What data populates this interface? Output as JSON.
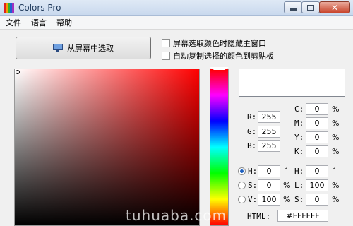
{
  "window": {
    "title": "Colors Pro",
    "app_icon_colors": [
      "#e02020",
      "#f0a000",
      "#30b030",
      "#2060d0",
      "#a030c0"
    ],
    "controls": {
      "minimize": "minimize",
      "maximize": "maximize",
      "close": "✕"
    }
  },
  "menu": [
    "文件",
    "语言",
    "帮助"
  ],
  "pick_button": {
    "label": "从屏幕中选取",
    "icon": "monitor-icon"
  },
  "options": [
    {
      "label": "屏幕选取颜色时隐藏主窗口",
      "checked": false
    },
    {
      "label": "自动复制选择的颜色到剪贴板",
      "checked": false
    }
  ],
  "picker": {
    "hue_color": "#ff0000",
    "preview_color": "#ffffff"
  },
  "rgb": {
    "r": {
      "label": "R:",
      "value": "255"
    },
    "g": {
      "label": "G:",
      "value": "255"
    },
    "b": {
      "label": "B:",
      "value": "255"
    }
  },
  "cmyk": {
    "c": {
      "label": "C:",
      "value": "0",
      "unit": "%"
    },
    "m": {
      "label": "M:",
      "value": "0",
      "unit": "%"
    },
    "y": {
      "label": "Y:",
      "value": "0",
      "unit": "%"
    },
    "k": {
      "label": "K:",
      "value": "0",
      "unit": "%"
    }
  },
  "hsv": {
    "h": {
      "label": "H:",
      "value": "0",
      "unit": "°",
      "selected": true
    },
    "s": {
      "label": "S:",
      "value": "0",
      "unit": "%",
      "selected": false
    },
    "v": {
      "label": "V:",
      "value": "100",
      "unit": "%",
      "selected": false
    }
  },
  "hsl": {
    "h": {
      "label": "H:",
      "value": "0",
      "unit": "°"
    },
    "l": {
      "label": "L:",
      "value": "100",
      "unit": "%"
    },
    "s": {
      "label": "S:",
      "value": "0",
      "unit": "%"
    }
  },
  "html": {
    "label": "HTML:",
    "value": "#FFFFFF"
  },
  "watermark": "tuhuaba.com"
}
